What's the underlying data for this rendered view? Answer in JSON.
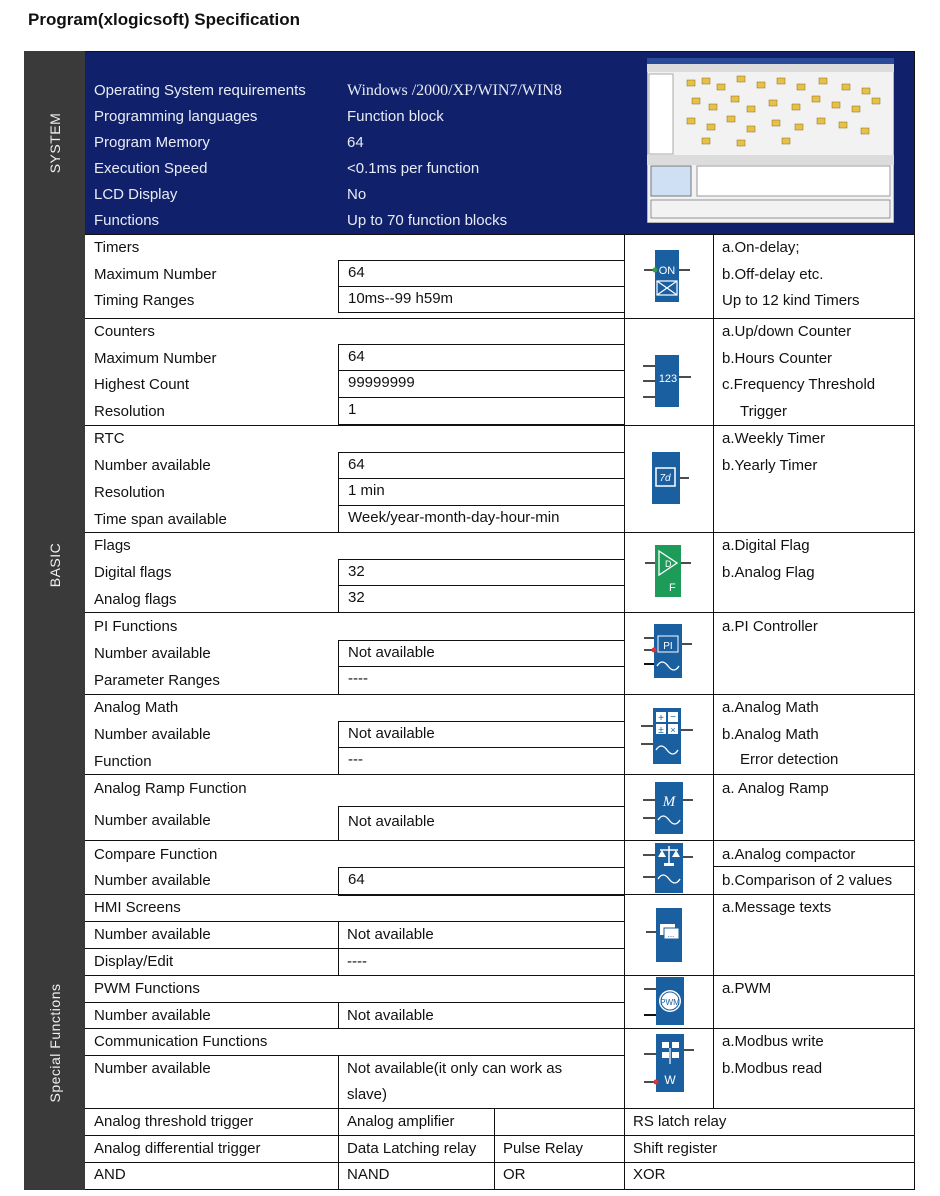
{
  "title": "Program(xlogicsoft) Specification",
  "sections": {
    "system": "SYSTEM",
    "basic": "BASIC",
    "special": "Special Functions"
  },
  "system": {
    "rows": [
      {
        "label": "Operating System requirements",
        "value": "Windows /2000/XP/WIN7/WIN8"
      },
      {
        "label": "Programming languages",
        "value": "Function block"
      },
      {
        "label": "Program Memory",
        "value": "64"
      },
      {
        "label": "Execution Speed",
        "value": "<0.1ms per function"
      },
      {
        "label": "LCD Display",
        "value": "No"
      },
      {
        "label": "Functions",
        "value": "Up to 70 function blocks"
      }
    ]
  },
  "basic": {
    "timers": {
      "header": "Timers",
      "rows": [
        {
          "label": "Maximum Number",
          "value": "64"
        },
        {
          "label": "Timing Ranges",
          "value": "10ms--99 h59m"
        }
      ],
      "desc": [
        "a.On-delay;",
        "b.Off-delay etc.",
        "Up to 12 kind Timers"
      ],
      "icon_text": "ON"
    },
    "counters": {
      "header": "Counters",
      "rows": [
        {
          "label": "Maximum Number",
          "value": "64"
        },
        {
          "label": "Highest Count",
          "value": "99999999"
        },
        {
          "label": "Resolution",
          "value": "1"
        }
      ],
      "desc": [
        "a.Up/down Counter",
        "b.Hours Counter",
        "c.Frequency Threshold",
        "Trigger"
      ],
      "icon_text": "123"
    },
    "rtc": {
      "header": "RTC",
      "rows": [
        {
          "label": "Number available",
          "value": "64"
        },
        {
          "label": "Resolution",
          "value": "1 min"
        },
        {
          "label": "Time span available",
          "value": "Week/year-month-day-hour-min"
        }
      ],
      "desc": [
        "a.Weekly Timer",
        "b.Yearly Timer"
      ],
      "icon_text": "7d"
    },
    "flags": {
      "header": "Flags",
      "rows": [
        {
          "label": "Digital flags",
          "value": "32"
        },
        {
          "label": "Analog flags",
          "value": "32"
        }
      ],
      "desc": [
        "a.Digital Flag",
        "b.Analog Flag"
      ],
      "icon_text": "DF"
    },
    "pi": {
      "header": "PI Functions",
      "rows": [
        {
          "label": "Number available",
          "value": "Not available"
        },
        {
          "label": "Parameter Ranges",
          "value": "----"
        }
      ],
      "desc": [
        "a.PI Controller"
      ],
      "icon_text": "PI"
    },
    "math": {
      "header": "Analog Math",
      "rows": [
        {
          "label": "Number available",
          "value": "Not available"
        },
        {
          "label": "Function",
          "value": "---"
        }
      ],
      "desc": [
        "a.Analog Math",
        "b.Analog Math",
        "Error detection"
      ]
    },
    "ramp": {
      "header": "Analog Ramp Function",
      "rows": [
        {
          "label": "Number available",
          "value": "Not available"
        }
      ],
      "desc": [
        "a. Analog Ramp"
      ]
    },
    "compare": {
      "header": "Compare Function",
      "rows": [
        {
          "label": "Number available",
          "value": "64"
        }
      ],
      "desc": [
        "a.Analog compactor",
        "b.Comparison of 2 values"
      ]
    }
  },
  "special": {
    "hmi": {
      "header": "HMI Screens",
      "rows": [
        {
          "label": "Number available",
          "value": "Not available"
        },
        {
          "label": "Display/Edit",
          "value": "----"
        }
      ],
      "desc": [
        "a.Message texts"
      ]
    },
    "pwm": {
      "header": "PWM Functions",
      "rows": [
        {
          "label": "Number available",
          "value": "Not available"
        }
      ],
      "desc": [
        "a.PWM"
      ],
      "icon_text": "PWM"
    },
    "comm": {
      "header": "Communication Functions",
      "rows": [
        {
          "label": "Number available",
          "value": "Not available(it only can work as",
          "value2": "slave)"
        }
      ],
      "desc": [
        "a.Modbus write",
        "b.Modbus read"
      ],
      "icon_text": "W"
    },
    "grid": [
      [
        "Analog threshold trigger",
        "Analog amplifier",
        "",
        "RS latch relay"
      ],
      [
        "Analog differential trigger",
        "Data Latching relay",
        "Pulse Relay",
        "Shift register"
      ],
      [
        "AND",
        "NAND",
        "OR",
        "XOR"
      ]
    ]
  },
  "colors": {
    "system_bg": "#10206a",
    "side_bg": "#3a3a3a",
    "icon_blue": "#1a5fa0"
  }
}
